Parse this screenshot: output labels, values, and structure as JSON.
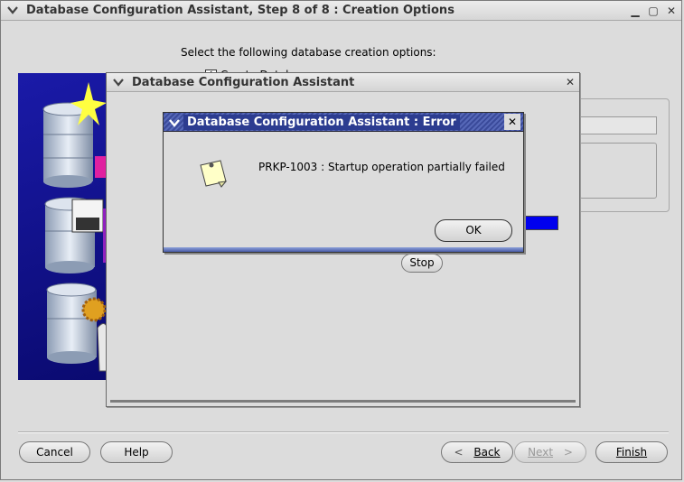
{
  "main_window": {
    "title": "Database Configuration Assistant, Step 8 of 8 : Creation Options",
    "instruction": "Select the following database creation options:",
    "create_database_label": "Create Database",
    "buttons": {
      "cancel": "Cancel",
      "help": "Help",
      "back": "Back",
      "next": "Next",
      "finish": "Finish"
    }
  },
  "progress_dialog": {
    "title": "Database Configuration Assistant",
    "stop_label": "Stop",
    "progress_color": "#0000ee"
  },
  "error_dialog": {
    "title": "Database Configuration Assistant : Error",
    "message": "PRKP-1003 : Startup operation partially failed",
    "ok_label": "OK",
    "icon": "note-icon"
  },
  "colors": {
    "error_titlebar": "#2c3c90",
    "background": "#dcdcdc"
  }
}
